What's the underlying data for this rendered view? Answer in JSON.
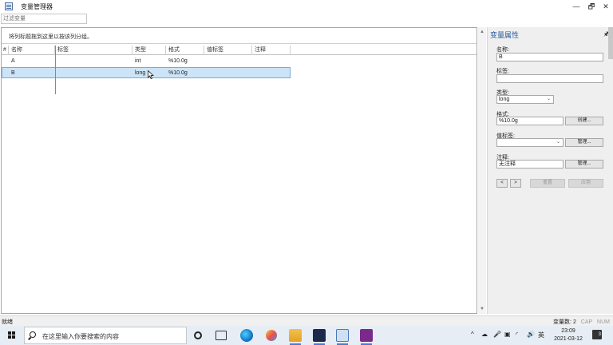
{
  "window": {
    "title": "变量管理器",
    "minimize_glyph": "—",
    "restore_glyph": "🗗",
    "close_glyph": "✕"
  },
  "filter": {
    "placeholder": "过滤变量"
  },
  "grid": {
    "group_hint": "将列标题拖到这里以按该列分组。",
    "columns": [
      "#",
      "名称",
      "标签",
      "类型",
      "格式",
      "值标签",
      "注释"
    ],
    "rows": [
      {
        "name": "A",
        "label": "",
        "type": "int",
        "format": "%10.0g",
        "value_label": "",
        "note": ""
      },
      {
        "name": "B",
        "label": "",
        "type": "long",
        "format": "%10.0g",
        "value_label": "",
        "note": ""
      }
    ]
  },
  "properties": {
    "title": "变量属性",
    "pin_glyph": "🖈",
    "name_label": "名称:",
    "name_value": "B",
    "label_label": "标签:",
    "label_value": "",
    "type_label": "类型:",
    "type_value": "long",
    "format_label": "格式:",
    "format_value": "%10.0g",
    "create_button": "创建...",
    "value_label_label": "值标签:",
    "value_label_value": "",
    "manage_button_1": "管理...",
    "note_label": "注释:",
    "note_value": "无注释",
    "manage_button_2": "管理...",
    "prev_button": "<",
    "next_button": ">",
    "reset_button": "重置",
    "apply_button": "应用"
  },
  "status": {
    "left": "就绪",
    "var_count_label": "变量数:",
    "var_count": "2",
    "cap": "CAP",
    "num": "NUM"
  },
  "taskbar": {
    "search_placeholder": "在这里输入你要搜索的内容",
    "ime": "英",
    "time": "23:09",
    "date": "2021-03-12",
    "notification_count": "3"
  },
  "colors": {
    "selection": "#cce4f7",
    "accent": "#2b579a",
    "taskbar": "#e7edf4"
  }
}
